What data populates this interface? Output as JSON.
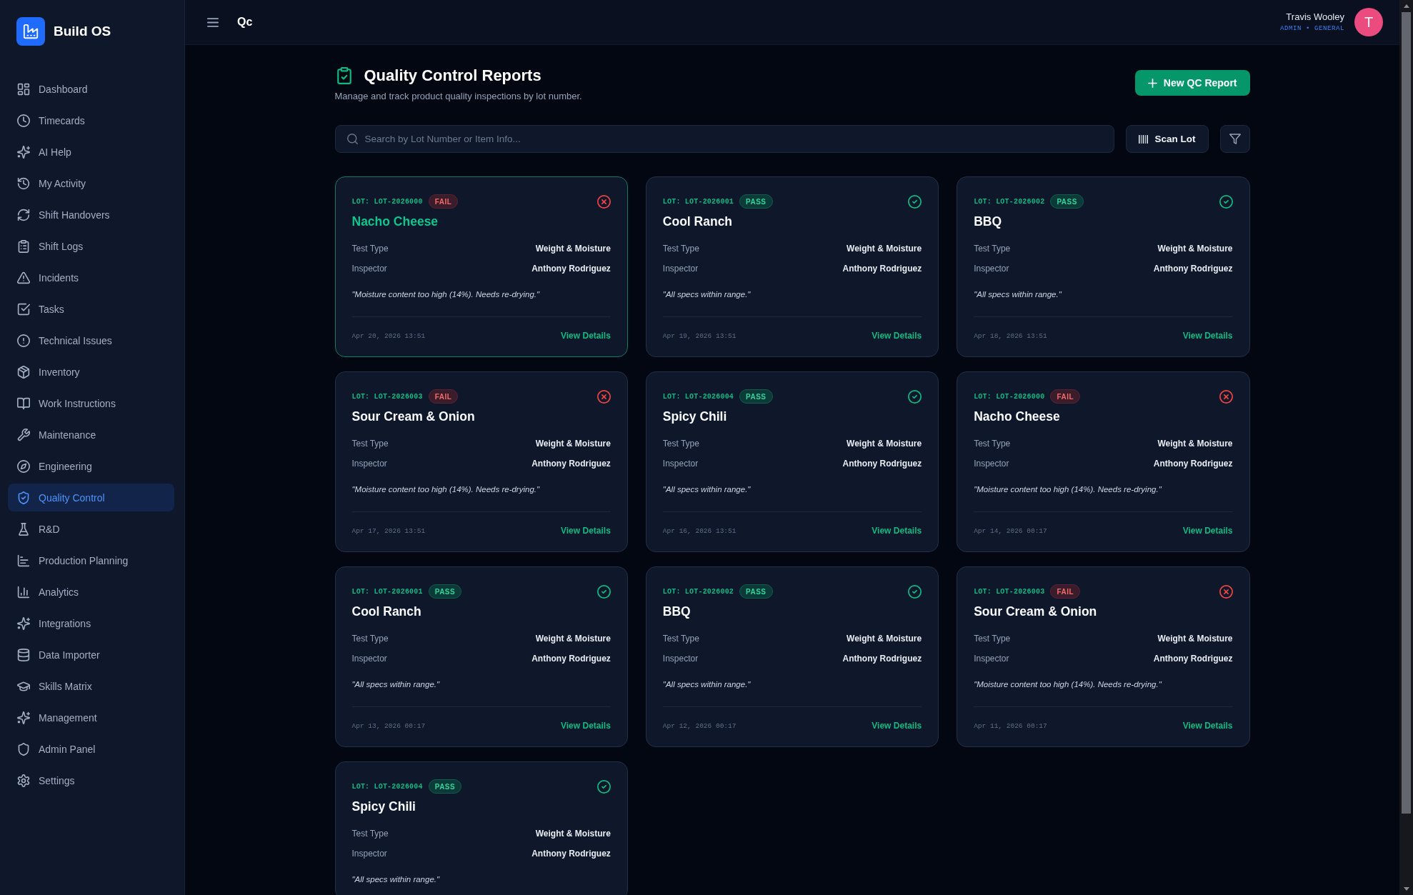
{
  "sidebar": {
    "brand": "Build OS",
    "items": [
      {
        "label": "Dashboard",
        "selected": false
      },
      {
        "label": "Timecards",
        "selected": false
      },
      {
        "label": "AI Help",
        "selected": false
      },
      {
        "label": "My Activity",
        "selected": false
      },
      {
        "label": "Shift Handovers",
        "selected": false
      },
      {
        "label": "Shift Logs",
        "selected": false
      },
      {
        "label": "Incidents",
        "selected": false
      },
      {
        "label": "Tasks",
        "selected": false
      },
      {
        "label": "Technical Issues",
        "selected": false
      },
      {
        "label": "Inventory",
        "selected": false
      },
      {
        "label": "Work Instructions",
        "selected": false
      },
      {
        "label": "Maintenance",
        "selected": false
      },
      {
        "label": "Engineering",
        "selected": false
      },
      {
        "label": "Quality Control",
        "selected": true
      },
      {
        "label": "R&D",
        "selected": false
      },
      {
        "label": "Production Planning",
        "selected": false
      },
      {
        "label": "Analytics",
        "selected": false
      },
      {
        "label": "Integrations",
        "selected": false
      },
      {
        "label": "Data Importer",
        "selected": false
      },
      {
        "label": "Skills Matrix",
        "selected": false
      },
      {
        "label": "Management",
        "selected": false
      },
      {
        "label": "Admin Panel",
        "selected": false
      },
      {
        "label": "Settings",
        "selected": false
      }
    ]
  },
  "header": {
    "title": "Qc",
    "user": {
      "name": "Travis Wooley",
      "role": "ADMIN • GENERAL",
      "avatar": "T"
    }
  },
  "page": {
    "title": "Quality Control Reports",
    "subtitle": "Manage and track product quality inspections by lot number.",
    "new_button": "New QC Report"
  },
  "toolbar": {
    "search": {
      "placeholder": "Search by Lot Number or Item Info..."
    },
    "scan_button": "Scan Lot"
  },
  "cards": [
    {
      "lot": "LOT: LOT-2026000",
      "kind": "fail",
      "badge": "FAIL",
      "hovered": true,
      "title": "Nacho Cheese",
      "details": [
        {
          "label": "Test Type",
          "value": "Weight & Moisture"
        },
        {
          "label": "Inspector",
          "value": "Anthony Rodriguez"
        }
      ],
      "note": "\"Moisture content too high (14%). Needs re-drying.\"",
      "date": "Apr 20, 2026 13:51",
      "link": "View Details"
    },
    {
      "lot": "LOT: LOT-2026001",
      "kind": "pass",
      "badge": "PASS",
      "hovered": false,
      "title": "Cool Ranch",
      "details": [
        {
          "label": "Test Type",
          "value": "Weight & Moisture"
        },
        {
          "label": "Inspector",
          "value": "Anthony Rodriguez"
        }
      ],
      "note": "\"All specs within range.\"",
      "date": "Apr 19, 2026 13:51",
      "link": "View Details"
    },
    {
      "lot": "LOT: LOT-2026002",
      "kind": "pass",
      "badge": "PASS",
      "hovered": false,
      "title": "BBQ",
      "details": [
        {
          "label": "Test Type",
          "value": "Weight & Moisture"
        },
        {
          "label": "Inspector",
          "value": "Anthony Rodriguez"
        }
      ],
      "note": "\"All specs within range.\"",
      "date": "Apr 18, 2026 13:51",
      "link": "View Details"
    },
    {
      "lot": "LOT: LOT-2026003",
      "kind": "fail",
      "badge": "FAIL",
      "hovered": false,
      "title": "Sour Cream & Onion",
      "details": [
        {
          "label": "Test Type",
          "value": "Weight & Moisture"
        },
        {
          "label": "Inspector",
          "value": "Anthony Rodriguez"
        }
      ],
      "note": "\"Moisture content too high (14%). Needs re-drying.\"",
      "date": "Apr 17, 2026 13:51",
      "link": "View Details"
    },
    {
      "lot": "LOT: LOT-2026004",
      "kind": "pass",
      "badge": "PASS",
      "hovered": false,
      "title": "Spicy Chili",
      "details": [
        {
          "label": "Test Type",
          "value": "Weight & Moisture"
        },
        {
          "label": "Inspector",
          "value": "Anthony Rodriguez"
        }
      ],
      "note": "\"All specs within range.\"",
      "date": "Apr 16, 2026 13:51",
      "link": "View Details"
    },
    {
      "lot": "LOT: LOT-2026000",
      "kind": "fail",
      "badge": "FAIL",
      "hovered": false,
      "title": "Nacho Cheese",
      "details": [
        {
          "label": "Test Type",
          "value": "Weight & Moisture"
        },
        {
          "label": "Inspector",
          "value": "Anthony Rodriguez"
        }
      ],
      "note": "\"Moisture content too high (14%). Needs re-drying.\"",
      "date": "Apr 14, 2026 00:17",
      "link": "View Details"
    },
    {
      "lot": "LOT: LOT-2026001",
      "kind": "pass",
      "badge": "PASS",
      "hovered": false,
      "title": "Cool Ranch",
      "details": [
        {
          "label": "Test Type",
          "value": "Weight & Moisture"
        },
        {
          "label": "Inspector",
          "value": "Anthony Rodriguez"
        }
      ],
      "note": "\"All specs within range.\"",
      "date": "Apr 13, 2026 00:17",
      "link": "View Details"
    },
    {
      "lot": "LOT: LOT-2026002",
      "kind": "pass",
      "badge": "PASS",
      "hovered": false,
      "title": "BBQ",
      "details": [
        {
          "label": "Test Type",
          "value": "Weight & Moisture"
        },
        {
          "label": "Inspector",
          "value": "Anthony Rodriguez"
        }
      ],
      "note": "\"All specs within range.\"",
      "date": "Apr 12, 2026 00:17",
      "link": "View Details"
    },
    {
      "lot": "LOT: LOT-2026003",
      "kind": "fail",
      "badge": "FAIL",
      "hovered": false,
      "title": "Sour Cream & Onion",
      "details": [
        {
          "label": "Test Type",
          "value": "Weight & Moisture"
        },
        {
          "label": "Inspector",
          "value": "Anthony Rodriguez"
        }
      ],
      "note": "\"Moisture content too high (14%). Needs re-drying.\"",
      "date": "Apr 11, 2026 00:17",
      "link": "View Details"
    },
    {
      "lot": "LOT: LOT-2026004",
      "kind": "pass",
      "badge": "PASS",
      "hovered": false,
      "title": "Spicy Chili",
      "details": [
        {
          "label": "Test Type",
          "value": "Weight & Moisture"
        },
        {
          "label": "Inspector",
          "value": "Anthony Rodriguez"
        }
      ],
      "note": "\"All specs within range.\""
    }
  ]
}
